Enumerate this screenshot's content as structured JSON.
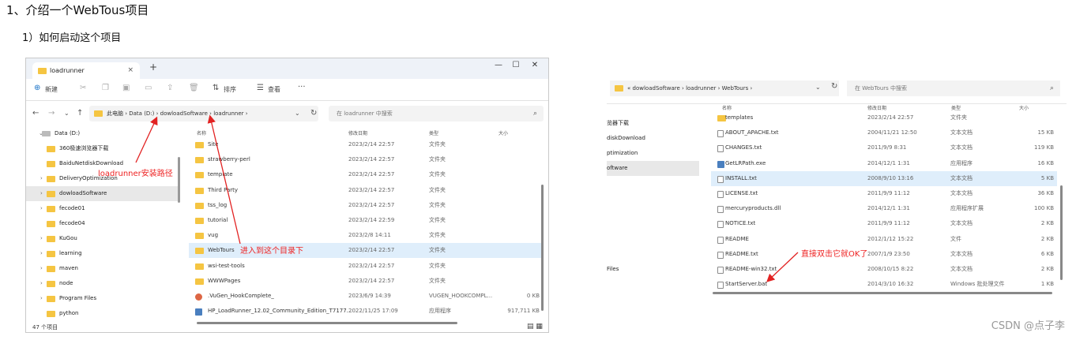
{
  "doc": {
    "heading1": "1、介绍一个WebTous项目",
    "heading2": "1）如何启动这个项目",
    "watermark": "CSDN @点子李"
  },
  "left_window": {
    "tab_title": "loadrunner",
    "tab_close": "×",
    "new_tab": "+",
    "window_controls": [
      "—",
      "☐",
      "✕"
    ],
    "toolbar": {
      "new_label": "新建",
      "sort_label": "排序",
      "view_label": "查看",
      "more_label": "···"
    },
    "breadcrumb": [
      "此电脑",
      "Data (D:)",
      "dowloadSoftware",
      "loadrunner"
    ],
    "search_placeholder": "在 loadrunner 中搜索",
    "sidebar": [
      {
        "label": "Data (D:)",
        "type": "drive",
        "expanded": true
      },
      {
        "label": "360极速浏览器下载",
        "type": "folder"
      },
      {
        "label": "BaiduNetdiskDownload",
        "type": "folder"
      },
      {
        "label": "DeliveryOptimization",
        "type": "folder"
      },
      {
        "label": "dowloadSoftware",
        "type": "folder",
        "selected": true
      },
      {
        "label": "fecode01",
        "type": "folder"
      },
      {
        "label": "fecode04",
        "type": "folder"
      },
      {
        "label": "KuGou",
        "type": "folder"
      },
      {
        "label": "learning",
        "type": "folder"
      },
      {
        "label": "maven",
        "type": "folder"
      },
      {
        "label": "node",
        "type": "folder"
      },
      {
        "label": "Program Files",
        "type": "folder"
      },
      {
        "label": "python",
        "type": "folder"
      }
    ],
    "columns": [
      "名称",
      "修改日期",
      "类型",
      "大小"
    ],
    "files": [
      {
        "name": "Site",
        "date": "2023/2/14 22:57",
        "type": "文件夹",
        "size": ""
      },
      {
        "name": "strawberry-perl",
        "date": "2023/2/14 22:57",
        "type": "文件夹",
        "size": ""
      },
      {
        "name": "template",
        "date": "2023/2/14 22:57",
        "type": "文件夹",
        "size": ""
      },
      {
        "name": "Third Party",
        "date": "2023/2/14 22:57",
        "type": "文件夹",
        "size": ""
      },
      {
        "name": "tss_log",
        "date": "2023/2/14 22:57",
        "type": "文件夹",
        "size": ""
      },
      {
        "name": "tutorial",
        "date": "2023/2/14 22:59",
        "type": "文件夹",
        "size": ""
      },
      {
        "name": "vug",
        "date": "2023/2/8 14:11",
        "type": "文件夹",
        "size": ""
      },
      {
        "name": "WebTours",
        "date": "2023/2/14 22:57",
        "type": "文件夹",
        "size": "",
        "selected": true
      },
      {
        "name": "wsi-test-tools",
        "date": "2023/2/14 22:57",
        "type": "文件夹",
        "size": ""
      },
      {
        "name": "WWWPages",
        "date": "2023/2/14 22:57",
        "type": "文件夹",
        "size": ""
      },
      {
        "name": ".VuGen_HookComplete_",
        "date": "2023/6/9 14:39",
        "type": "VUGEN_HOOKCOMPL...",
        "size": "0 KB"
      },
      {
        "name": "HP_LoadRunner_12.02_Community_Edition_T7177...",
        "date": "2022/11/25 17:09",
        "type": "应用程序",
        "size": "917,711 KB"
      }
    ],
    "status": "47 个项目",
    "view_icons": "▤ ▦"
  },
  "right_window": {
    "breadcrumb": [
      "«",
      "dowloadSoftware",
      "loadrunner",
      "WebTours"
    ],
    "search_placeholder": "在 WebTours 中搜索",
    "sidebar": [
      {
        "label": "览器下载"
      },
      {
        "label": "diskDownload"
      },
      {
        "label": "ptimization"
      },
      {
        "label": "oftware",
        "selected": true
      },
      {
        "label": "Files"
      }
    ],
    "columns": [
      "名称",
      "修改日期",
      "类型",
      "大小"
    ],
    "files": [
      {
        "name": "templates",
        "date": "2023/2/14 22:57",
        "type": "文件夹",
        "size": "",
        "icon": "folder"
      },
      {
        "name": "ABOUT_APACHE.txt",
        "date": "2004/11/21 12:50",
        "type": "文本文档",
        "size": "15 KB",
        "icon": "doc"
      },
      {
        "name": "CHANGES.txt",
        "date": "2011/9/9 8:31",
        "type": "文本文档",
        "size": "119 KB",
        "icon": "doc"
      },
      {
        "name": "GetLRPath.exe",
        "date": "2014/12/1 1:31",
        "type": "应用程序",
        "size": "16 KB",
        "icon": "exe"
      },
      {
        "name": "INSTALL.txt",
        "date": "2008/9/10 13:16",
        "type": "文本文档",
        "size": "5 KB",
        "icon": "doc",
        "selected": true
      },
      {
        "name": "LICENSE.txt",
        "date": "2011/9/9 11:12",
        "type": "文本文档",
        "size": "36 KB",
        "icon": "doc"
      },
      {
        "name": "mercuryproducts.dll",
        "date": "2014/12/1 1:31",
        "type": "应用程序扩展",
        "size": "100 KB",
        "icon": "doc"
      },
      {
        "name": "NOTICE.txt",
        "date": "2011/9/9 11:12",
        "type": "文本文档",
        "size": "2 KB",
        "icon": "doc"
      },
      {
        "name": "README",
        "date": "2012/1/12 15:22",
        "type": "文件",
        "size": "2 KB",
        "icon": "doc"
      },
      {
        "name": "README.txt",
        "date": "2007/1/9 23:50",
        "type": "文本文档",
        "size": "6 KB",
        "icon": "doc"
      },
      {
        "name": "README-win32.txt",
        "date": "2008/10/15 8:22",
        "type": "文本文档",
        "size": "2 KB",
        "icon": "doc"
      },
      {
        "name": "StartServer.bat",
        "date": "2014/3/10 16:32",
        "type": "Windows 批处理文件",
        "size": "1 KB",
        "icon": "doc"
      }
    ]
  },
  "annotations": {
    "install_path": "loadrunner安装路径",
    "enter_dir": "进入到这个目录下",
    "double_click": "直接双击它就OK了",
    "color": "#e22222"
  }
}
